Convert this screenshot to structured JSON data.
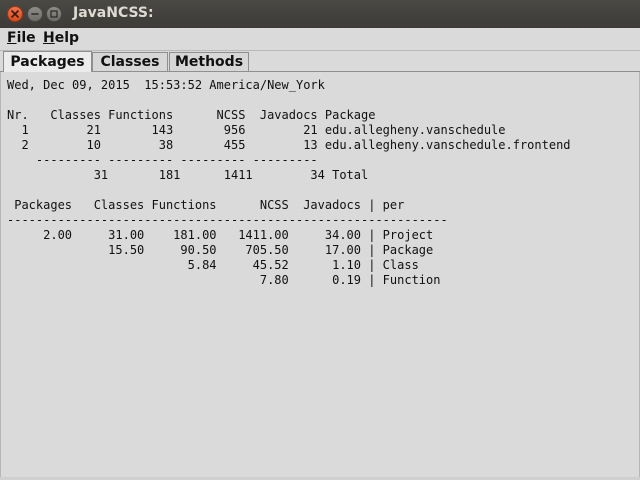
{
  "window": {
    "title": "JavaNCSS:"
  },
  "menubar": {
    "file": {
      "mnemonic": "F",
      "rest": "ile"
    },
    "help": {
      "mnemonic": "H",
      "rest": "elp"
    }
  },
  "tabs": [
    {
      "label": "Packages",
      "selected": true
    },
    {
      "label": "Classes",
      "selected": false
    },
    {
      "label": "Methods",
      "selected": false
    }
  ],
  "report": {
    "timestamp": "Wed, Dec 09, 2015  15:53:52 America/New_York",
    "package_table": {
      "header": "Nr.   Classes Functions      NCSS  Javadocs Package",
      "rows": [
        "  1        21       143       956        21 edu.allegheny.vanschedule",
        "  2        10        38       455        13 edu.allegheny.vanschedule.frontend"
      ],
      "separator": "    --------- --------- --------- ---------",
      "total": "            31       181      1411        34 Total"
    },
    "average_table": {
      "header": " Packages   Classes Functions      NCSS  Javadocs | per",
      "separator": "-------------------------------------------------------------",
      "rows": [
        "     2.00     31.00    181.00   1411.00     34.00 | Project",
        "              15.50     90.50    705.50     17.00 | Package",
        "                         5.84     45.52      1.10 | Class",
        "                                   7.80      0.19 | Function"
      ]
    }
  },
  "colors": {
    "titlebar": "#3c3b37",
    "close_button": "#e05a2b",
    "window_bg": "#dadada"
  }
}
